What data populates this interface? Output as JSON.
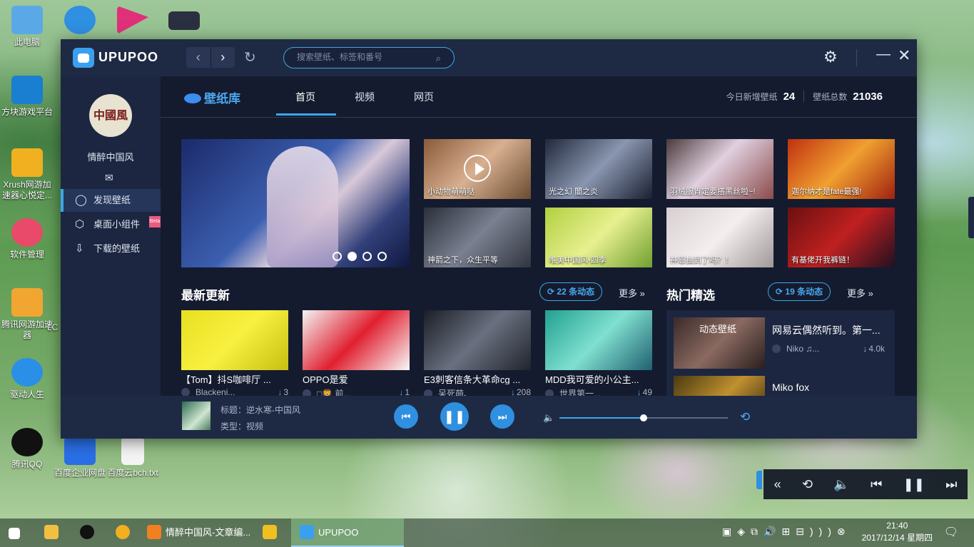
{
  "desktop": {
    "icons": [
      {
        "label": "此电脑",
        "color": "#5aa9e6"
      },
      {
        "label": "方块游戏平台",
        "color": "#1a7fd0"
      },
      {
        "label": "Xrush网游加速器心悦定...",
        "color": "#f0b020"
      },
      {
        "label": "软件管理",
        "color": "#e94a6a"
      },
      {
        "label": "腾讯网游加速器",
        "color": "#f2a632"
      },
      {
        "label": "驱动人生",
        "color": "#2a8fe6"
      },
      {
        "label": "腾讯QQ",
        "color": "#111111"
      },
      {
        "label": "百度企业网盘",
        "color": "#2a6fe6"
      },
      {
        "label": "百度云bch.txt",
        "color": "#f4f4f4"
      }
    ],
    "partial_label": "LC"
  },
  "app": {
    "name": "UPUPOO",
    "search_placeholder": "搜索壁纸、标签和番号",
    "user": {
      "name": "情醉中国风",
      "avatar_text": "中國風"
    },
    "sidebar": [
      {
        "label": "发现壁纸",
        "icon": "planet-icon",
        "glyph": "◯",
        "active": true
      },
      {
        "label": "桌面小组件",
        "icon": "widget-icon",
        "glyph": "⬡",
        "active": false,
        "badge": "Beta"
      },
      {
        "label": "下载的壁纸",
        "icon": "download-icon",
        "glyph": "⇩",
        "active": false
      }
    ],
    "library_title": "壁纸库",
    "tabs": [
      {
        "label": "首页",
        "active": true
      },
      {
        "label": "视频",
        "active": false
      },
      {
        "label": "网页",
        "active": false
      }
    ],
    "stats": {
      "today_label": "今日新增壁纸",
      "today_value": "24",
      "total_label": "壁纸总数",
      "total_value": "21036"
    },
    "banner": {
      "page_count": 4,
      "active_index": 1
    },
    "featured": [
      {
        "caption": "小动物萌萌哒",
        "bg": "linear-gradient(135deg,#8a5a3a,#d8b090 50%,#6a4a30)",
        "video": true
      },
      {
        "caption": "光之幻 闇之炎",
        "bg": "linear-gradient(135deg,#20283a,#8a96b0 50%,#1a2030)",
        "video": false
      },
      {
        "caption": "羽绒服肯定要搭黑丝啦~!",
        "bg": "linear-gradient(135deg,#4a3a3a,#e0d0e0 45%,#8a4a4a)",
        "video": false
      },
      {
        "caption": "迦尔纳才是fate最强!",
        "bg": "linear-gradient(135deg,#c03010,#f0a030 50%,#a02010)",
        "video": false
      },
      {
        "caption": "神箭之下，众生平等",
        "bg": "linear-gradient(135deg,#2a2f3a,#7a8090 50%,#30343e)",
        "video": false
      },
      {
        "caption": "唯美中国风-四季",
        "bg": "linear-gradient(135deg,#b0d040,#e8f090 50%,#70a030)",
        "video": false
      },
      {
        "caption": "神恩抽到了吗？！",
        "bg": "linear-gradient(135deg,#d8d0d0,#f4eeee 50%,#a09898)",
        "video": false
      },
      {
        "caption": "有基佬开我裤链！",
        "bg": "linear-gradient(135deg,#6a1010,#c02020 50%,#201020)",
        "video": false
      }
    ],
    "latest": {
      "title": "最新更新",
      "pill": "22 条动态",
      "more": "更多",
      "cards": [
        {
          "title": "【Tom】抖S咖啡厅 ...",
          "author": "Blackeni...",
          "count": "3",
          "bg": "linear-gradient(135deg,#e8e020,#f8f040 50%,#c8c010)"
        },
        {
          "title": "OPPO是爱",
          "author": "□🦁 前...",
          "count": "1",
          "bg": "linear-gradient(135deg,#f4f4f4,#e02030 50%,#f8f8f8)"
        },
        {
          "title": "E3刺客信条大革命cg ...",
          "author": "呆死萌、",
          "count": "208",
          "bg": "linear-gradient(135deg,#1a1e26,#6a7080 50%,#20242c)"
        },
        {
          "title": "MDD我可爱的小公主...",
          "author": "世界第一...",
          "count": "49",
          "bg": "linear-gradient(135deg,#20a090,#80e0d0 50%,#206070)"
        }
      ]
    },
    "hot": {
      "title": "热门精选",
      "pill": "19 条动态",
      "more": "更多",
      "items": [
        {
          "title": "网易云偶然听到。第一...",
          "author": "Niko ♫...",
          "count": "4.0k",
          "thumb_text": "动态壁纸",
          "bg": "linear-gradient(135deg,#3a2a2a,#8a6a60 50%,#2a1e1e)"
        },
        {
          "title": "Miko fox",
          "author": "",
          "count": "",
          "thumb_text": "",
          "bg": "linear-gradient(135deg,#4a3a10,#c09030 50%,#2a2010)"
        }
      ]
    },
    "player": {
      "title_label": "标题：逆水寒-中国风",
      "type_label": "类型：视频",
      "volume": 0.5
    }
  },
  "taskbar": {
    "items": [
      {
        "label": "",
        "icon": "windows-start-icon"
      },
      {
        "label": "",
        "icon": "file-explorer-icon"
      },
      {
        "label": "",
        "icon": "qq-icon"
      },
      {
        "label": "",
        "icon": "browser-icon"
      },
      {
        "label": "情醉中国风-文章编...",
        "icon": "uc-browser-icon"
      },
      {
        "label": "",
        "icon": "g-app-icon"
      },
      {
        "label": "UPUPOO",
        "icon": "upupoo-icon",
        "active": true
      }
    ],
    "time": "21:40",
    "date": "2017/12/14 星期四"
  },
  "colors": {
    "accent": "#3da6e8",
    "window_bg": "#141b2e",
    "titlebar_bg": "#1e2a44"
  }
}
